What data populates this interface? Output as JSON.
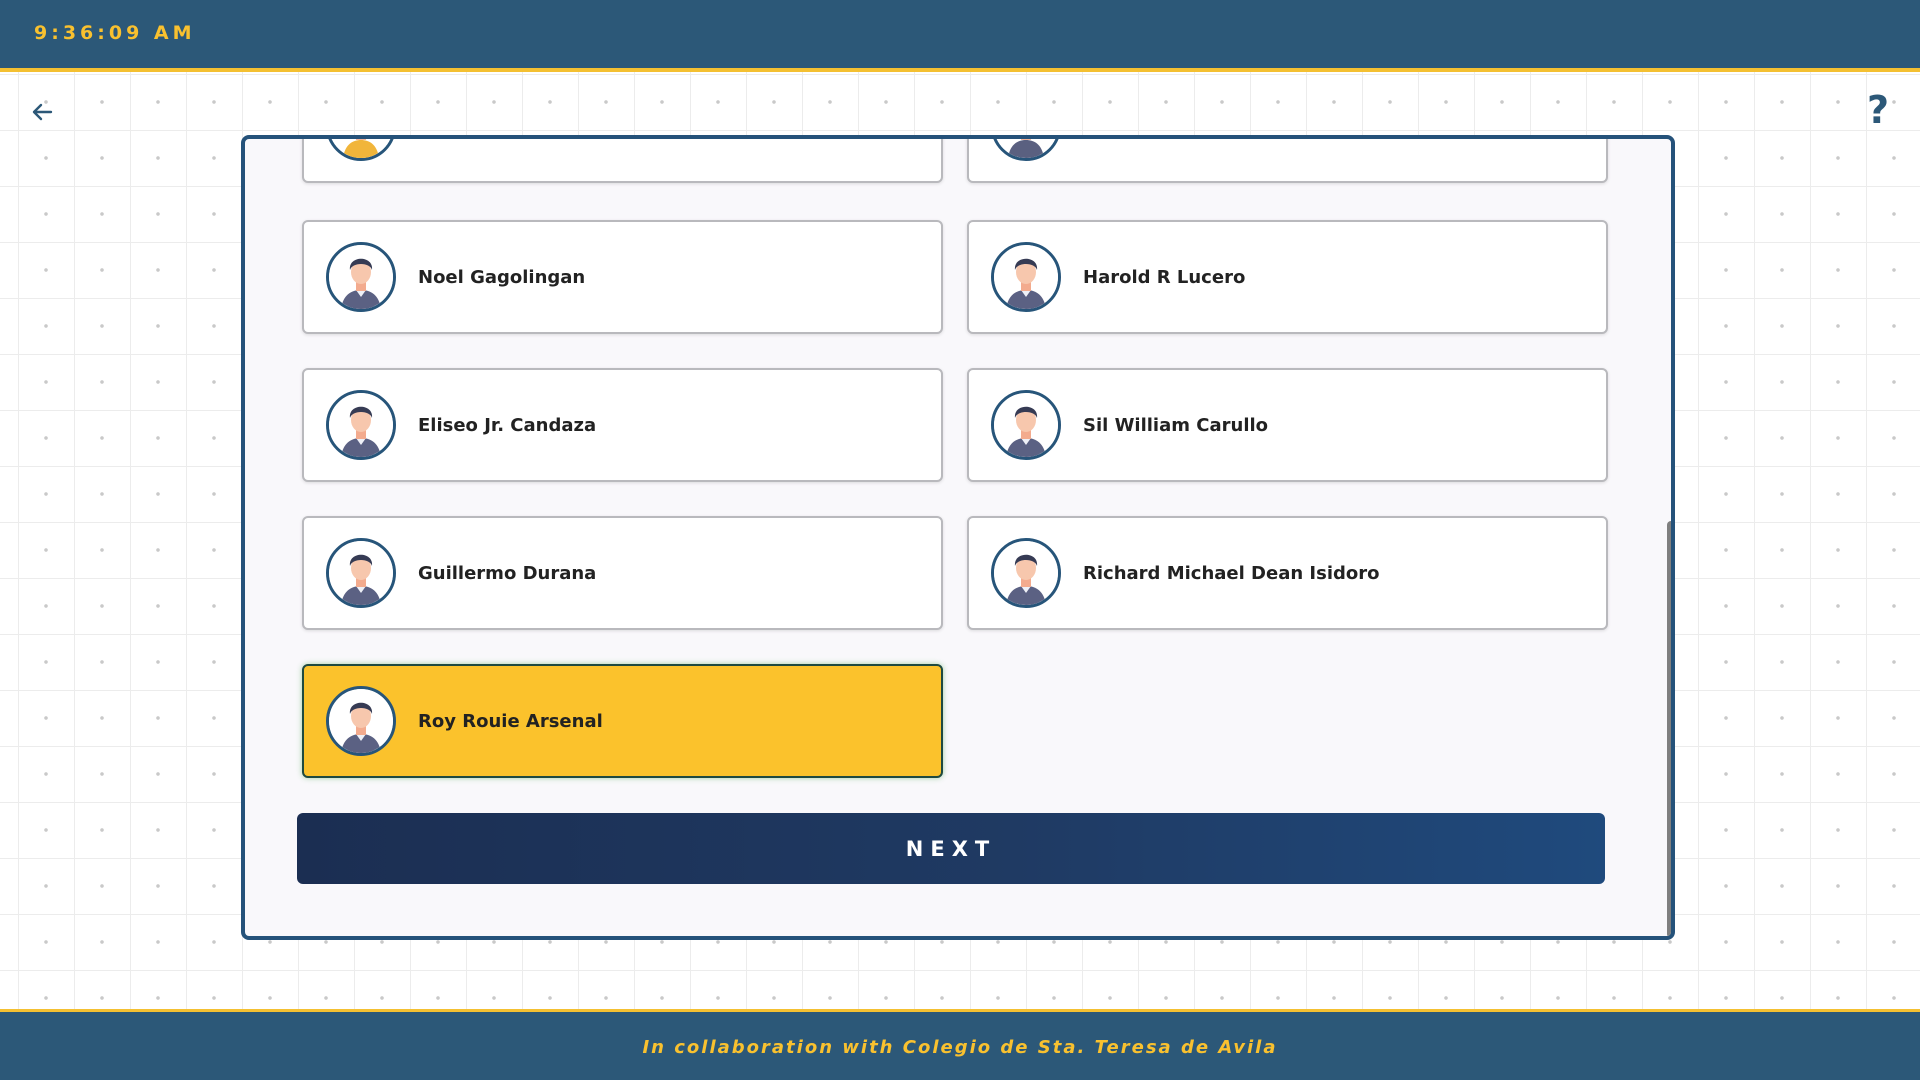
{
  "header": {
    "clock": "9:36:09 AM"
  },
  "nav": {
    "back_icon": "arrow-left-icon",
    "help_label": "?"
  },
  "people": [
    {
      "name": "",
      "selected": false
    },
    {
      "name": "",
      "selected": false
    },
    {
      "name": "Noel Gagolingan",
      "selected": false
    },
    {
      "name": "Harold R Lucero",
      "selected": false
    },
    {
      "name": "Eliseo Jr. Candaza",
      "selected": false
    },
    {
      "name": "Sil William Carullo",
      "selected": false
    },
    {
      "name": "Guillermo Durana",
      "selected": false
    },
    {
      "name": "Richard Michael Dean Isidoro",
      "selected": false
    },
    {
      "name": "Roy Rouie Arsenal",
      "selected": true
    }
  ],
  "actions": {
    "next_label": "NEXT"
  },
  "footer": {
    "text": "In collaboration with Colegio de Sta. Teresa de Avila"
  },
  "colors": {
    "header_bg": "#2c5878",
    "accent_yellow": "#fbc22c",
    "panel_border": "#25527a",
    "next_button": "#1f3a63"
  }
}
